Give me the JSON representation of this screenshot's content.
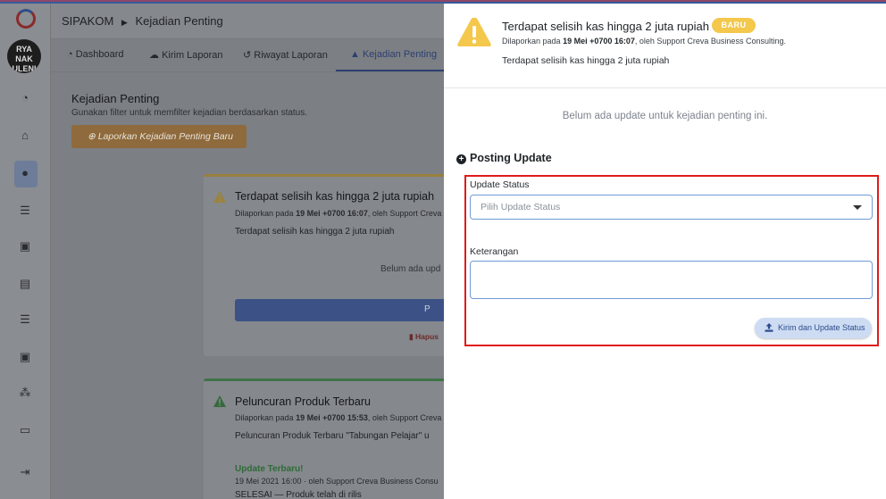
{
  "app": {
    "name": "SIPAKOM",
    "current_page": "Kejadian Penting",
    "avatar_text": "RYA NAK ULENI"
  },
  "tabs": [
    {
      "label": "Dashboard",
      "icon": "gauge-icon"
    },
    {
      "label": "Kirim Laporan",
      "icon": "cloud-upload-icon"
    },
    {
      "label": "Riwayat Laporan",
      "icon": "history-icon"
    },
    {
      "label": "Kejadian Penting",
      "icon": "warning-icon"
    }
  ],
  "page": {
    "title": "Kejadian Penting",
    "subtitle": "Gunakan filter untuk memfilter kejadian berdasarkan status.",
    "report_button": "Laporkan Kejadian Penting Baru"
  },
  "cards": [
    {
      "title": "Terdapat selisih kas hingga 2 juta rupiah",
      "meta_prefix": "Dilaporkan pada",
      "meta_date": "19 Mei +0700 16:07",
      "meta_suffix": ", oleh Support Creva",
      "body": "Terdapat selisih kas hingga 2 juta rupiah",
      "empty_text": "Belum ada upd",
      "button_text": "P",
      "delete_text": "Hapus"
    },
    {
      "title": "Peluncuran Produk Terbaru",
      "meta_prefix": "Dilaporkan pada",
      "meta_date": "19 Mei +0700 15:53",
      "meta_suffix": ", oleh Support Creva",
      "body": "Peluncuran Produk Terbaru \"Tabungan Pelajar\" u",
      "update_label": "Update Terbaru!",
      "update_meta": "19 Mei 2021 16:00 · oleh Support Creva Business Consu",
      "update_text": "SELESAI — Produk telah di rilis"
    }
  ],
  "panel": {
    "title": "Terdapat selisih kas hingga 2 juta rupiah",
    "badge": "BARU",
    "meta_prefix": "Dilaporkan pada",
    "meta_date": "19 Mei +0700 16:07",
    "meta_suffix": ", oleh Support Creva Business Consulting.",
    "body": "Terdapat selisih kas hingga 2 juta rupiah",
    "empty_text": "Belum ada update untuk kejadian penting ini.",
    "posting_heading": "Posting Update",
    "status_label": "Update Status",
    "status_placeholder": "Pilih Update Status",
    "note_label": "Keterangan",
    "note_value": "",
    "submit_button": "Kirim dan Update Status"
  },
  "colors": {
    "warning": "#f3c84c",
    "badge": "#f3c84c",
    "highlight_box": "#e01a1a",
    "input_border": "#6f9ad8",
    "submit_bg": "#cddcf3"
  }
}
